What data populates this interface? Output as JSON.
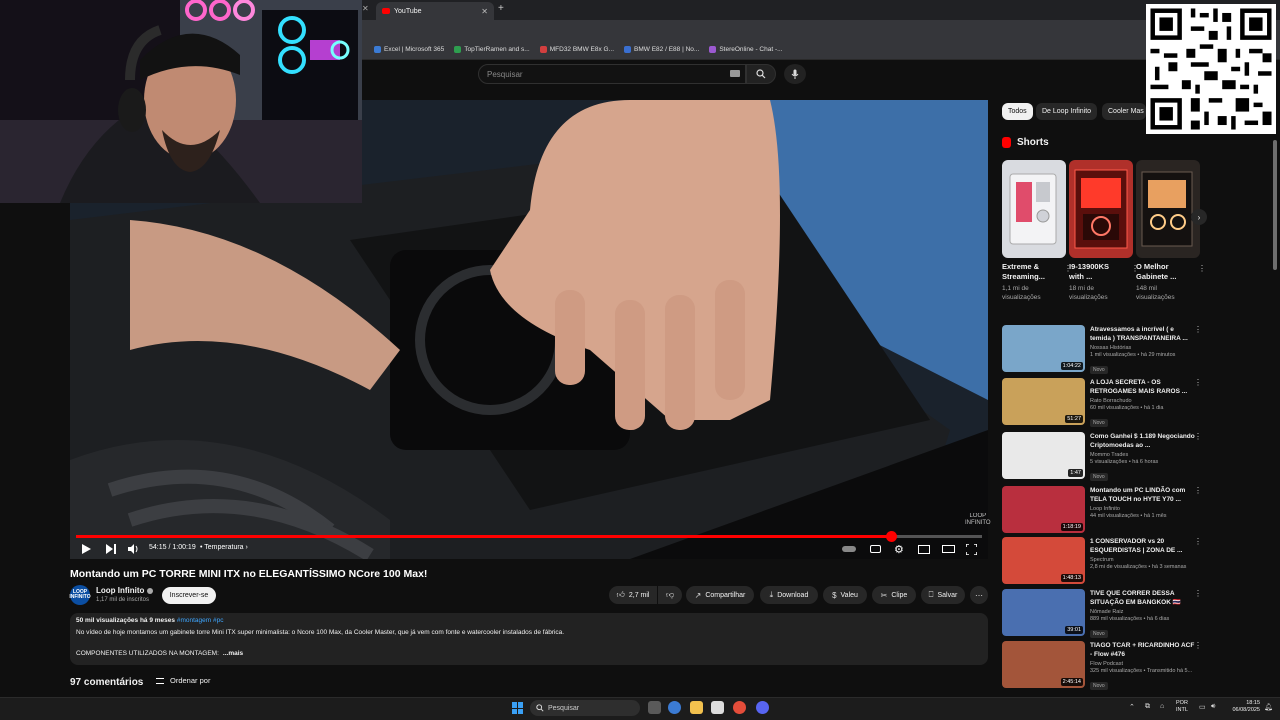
{
  "browser": {
    "tab_title": "YouTube",
    "bookmarks": [
      {
        "label": "Excel | Microsoft 365",
        "color": "#3b7bd4"
      },
      {
        "label": "TopTierRamen and s...",
        "color": "#2e9e4f"
      },
      {
        "label": "MFD32 BMW E8x G...",
        "color": "#d23f3f"
      },
      {
        "label": "BMW E82 / E88 | No...",
        "color": "#3a6fd0"
      },
      {
        "label": "StereOnline - Chat -...",
        "color": "#9b59d0"
      }
    ]
  },
  "masthead": {
    "search_placeholder": "Pesquisar"
  },
  "player": {
    "time": "54:15 / 1:00:19",
    "chapter": "• Temperatura ›",
    "progress": 0.9,
    "watermark_line1": "LOOP",
    "watermark_line2": "INFINITO"
  },
  "video": {
    "title": "Montando um PC TORRE MINI ITX no ELEGANTÍSSIMO NCore 100 Max!",
    "channel": "Loop Infinito",
    "channel_avatar_text": "LOOP INFINITO",
    "subscribers": "1,17 mil de inscritos",
    "subscribe_label": "Inscrever-se",
    "likes": "2,7 mil",
    "share_label": "Compartilhar",
    "download_label": "Download",
    "thanks_label": "Valeu",
    "clip_label": "Clipe",
    "save_label": "Salvar",
    "stats": "50 mil visualizações  há 9 meses",
    "tags": "#montagem #pc",
    "description_line1": "No vídeo de hoje montamos um gabinete torre Mini ITX super minimalista: o Ncore 100 Max, da Cooler Master, que já vem com fonte e watercooler instalados de fábrica.",
    "description_line2": "COMPONENTES UTILIZADOS NA MONTAGEM:",
    "description_more": "...mais",
    "comments_count": "97 comentários",
    "sort_label": "Ordenar por"
  },
  "sidebar": {
    "chips": [
      "Todos",
      "De Loop Infinito",
      "Cooler Mas"
    ],
    "shorts_title": "Shorts",
    "shorts": [
      {
        "title_line1": "Extreme &",
        "title_line2": "Streaming...",
        "views_line1": "1,1 mi de",
        "views_line2": "visualizações",
        "color": "#d9dbe0"
      },
      {
        "title_line1": "I9-13900KS",
        "title_line2": "with ...",
        "views_line1": "18 mi de",
        "views_line2": "visualizações",
        "color": "#b0302a"
      },
      {
        "title_line1": "O Melhor",
        "title_line2": "Gabinete ...",
        "views_line1": "148 mil",
        "views_line2": "visualizações",
        "color": "#2a2522"
      }
    ],
    "recommendations": [
      {
        "title": "Atravessamos a incrível ( e temida ) TRANSPANTANEIRA ...",
        "channel": "Nossas Histórias",
        "views": "1 mil visualizações • há 29 minutos",
        "badge": "Novo",
        "duration": "1:04:22",
        "color": "#7aa6c9"
      },
      {
        "title": "A LOJA SECRETA - OS RETROGAMES MAIS RAROS ...",
        "channel": "Rato Borrachudo",
        "views": "60 mil visualizações • há 1 dia",
        "badge": "Novo",
        "duration": "51:27",
        "color": "#c9a15a"
      },
      {
        "title": "Como Ganhei $ 1.189 Negociando Criptomoedas ao ...",
        "channel": "Mommo Trades",
        "views": "5 visualizações • há 6 horas",
        "badge": "Novo",
        "duration": "1:47",
        "color": "#e9e9e9"
      },
      {
        "title": "Montando um PC LINDÃO com TELA TOUCH no HYTE Y70 ...",
        "channel": "Loop Infinito",
        "views": "44 mil visualizações • há 1 mês",
        "badge": "",
        "duration": "1:18:19",
        "color": "#b92f3e"
      },
      {
        "title": "1 CONSERVADOR vs 20 ESQUERDISTAS | ZONA DE ...",
        "channel": "Spectrum",
        "views": "2,8 mi de visualizações • há 3 semanas",
        "badge": "",
        "duration": "1:48:13",
        "color": "#d44a3a"
      },
      {
        "title": "TIVE QUE CORRER DESSA SITUAÇÃO EM BANGKOK 🇹🇭",
        "channel": "Nômade Raiz",
        "views": "889 mil visualizações • há 6 dias",
        "badge": "Novo",
        "duration": "39:01",
        "color": "#4a6fb0"
      },
      {
        "title": "TIAGO TCAR + RICARDINHO ACF - Flow #476",
        "channel": "Flow Podcast",
        "views": "325 mil visualizações • Transmitido há 5...",
        "badge": "Novo",
        "duration": "2:45:14",
        "color": "#a3553a"
      }
    ]
  },
  "taskbar": {
    "search_placeholder": "Pesquisar",
    "lang_line1": "POR",
    "lang_line2": "INTL",
    "time": "18:15",
    "date": "06/08/2025"
  }
}
